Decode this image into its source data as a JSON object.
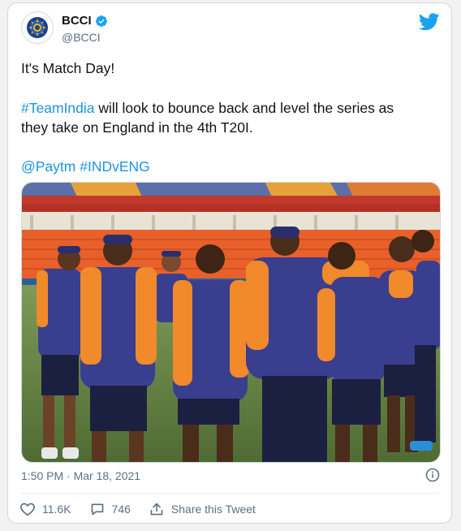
{
  "tweet": {
    "display_name": "BCCI",
    "handle": "@BCCI",
    "line1": "It's Match Day!",
    "hashtag_team": "#TeamIndia",
    "line2_rest": " will look to bounce back and level the series as",
    "line3": "they take on England in the 4th T20I.",
    "mention": "@Paytm",
    "hashtag_match": "#INDvENG",
    "timestamp": "1:50 PM · Mar 18, 2021",
    "likes": "11.6K",
    "replies": "746",
    "share_label": "Share this Tweet"
  },
  "colors": {
    "link": "#1b95e0",
    "twitter_blue": "#1da1f2",
    "jersey_blue": "#3a3e8f",
    "jersey_orange": "#f08a2b",
    "stadium_orange": "#e8602a"
  },
  "icons": [
    "bcci-logo",
    "verified-badge-icon",
    "twitter-bird-icon",
    "info-icon",
    "heart-icon",
    "reply-icon",
    "share-icon"
  ]
}
